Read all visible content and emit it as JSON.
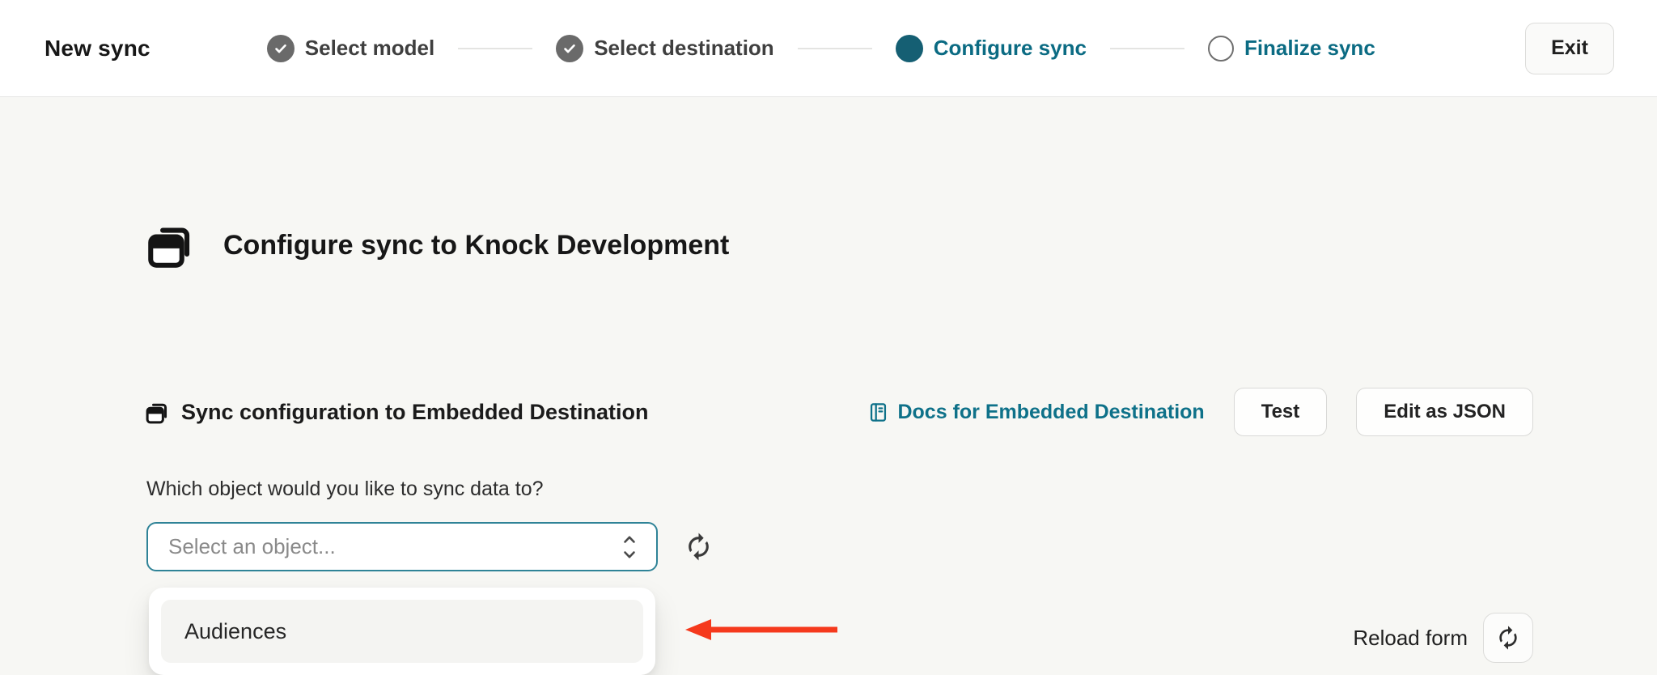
{
  "header": {
    "title": "New sync",
    "steps": [
      {
        "label": "Select model",
        "state": "complete"
      },
      {
        "label": "Select destination",
        "state": "complete"
      },
      {
        "label": "Configure sync",
        "state": "active"
      },
      {
        "label": "Finalize sync",
        "state": "upcoming"
      }
    ],
    "exit_label": "Exit"
  },
  "main": {
    "page_title": "Configure sync to Knock Development",
    "section": {
      "title": "Sync configuration to Embedded Destination",
      "docs_link_label": "Docs for Embedded Destination",
      "test_button_label": "Test",
      "edit_json_button_label": "Edit as JSON"
    },
    "form": {
      "question_label": "Which object would you like to sync data to?",
      "select_placeholder": "Select an object...",
      "dropdown_options": [
        "Audiences"
      ]
    },
    "reload": {
      "label": "Reload form"
    }
  },
  "icons": {
    "step_complete": "check-circle-icon",
    "step_active": "filled-dot-icon",
    "step_upcoming": "empty-circle-icon",
    "page_title_icon": "stacked-windows-icon",
    "docs_icon": "book-icon",
    "select_icon": "chevron-up-down-icon",
    "refresh_icon": "circular-arrows-icon",
    "annotation": "red-arrow-left-icon"
  },
  "colors": {
    "accent_teal": "#0b6b83",
    "active_step_dot": "#155f73",
    "completed_step_gray": "#6a6a6a",
    "select_focus_border": "#2f8397",
    "arrow_red": "#f5391c",
    "page_background": "#f7f7f4",
    "header_background": "#ffffff"
  }
}
